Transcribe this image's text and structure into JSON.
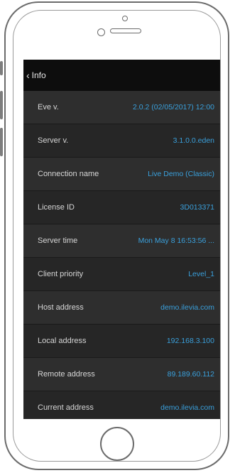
{
  "navbar": {
    "back_label": "Info"
  },
  "rows": [
    {
      "label": "Eve v.",
      "value": "2.0.2 (02/05/2017) 12:00"
    },
    {
      "label": "Server v.",
      "value": "3.1.0.0.eden"
    },
    {
      "label": "Connection name",
      "value": "Live Demo (Classic)"
    },
    {
      "label": "License ID",
      "value": "3D013371"
    },
    {
      "label": "Server time",
      "value": "Mon May  8 16:53:56 ..."
    },
    {
      "label": "Client priority",
      "value": "Level_1"
    },
    {
      "label": "Host address",
      "value": "demo.ilevia.com"
    },
    {
      "label": "Local address",
      "value": "192.168.3.100"
    },
    {
      "label": "Remote address",
      "value": "89.189.60.112"
    },
    {
      "label": "Current address",
      "value": "demo.ilevia.com"
    }
  ],
  "colors": {
    "value": "#3aa0dc",
    "navbar": "#0d0d0d",
    "row": "#2e2e2e"
  }
}
